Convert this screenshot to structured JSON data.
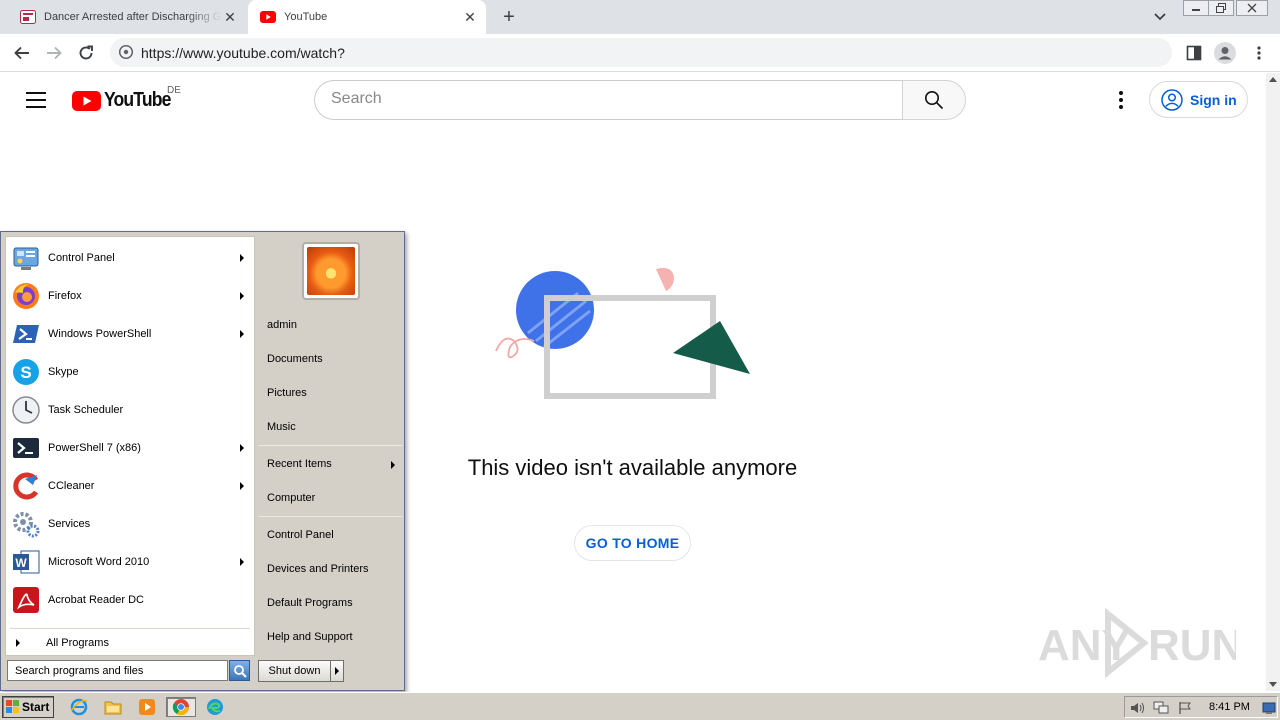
{
  "browser": {
    "tabs": [
      {
        "title": "Dancer Arrested after Discharging G",
        "active": false
      },
      {
        "title": "YouTube",
        "active": true
      }
    ],
    "url": "https://www.youtube.com/watch?"
  },
  "youtube": {
    "logo_text": "YouTube",
    "country_code": "DE",
    "search_placeholder": "Search",
    "sign_in_label": "Sign in",
    "unavailable_message": "This video isn't available anymore",
    "go_home_label": "GO TO HOME",
    "brand_color": "#ff0000",
    "link_color": "#065fd4"
  },
  "start_menu": {
    "programs": [
      {
        "label": "Control Panel",
        "icon": "control-panel-icon",
        "submenu": true
      },
      {
        "label": "Firefox",
        "icon": "firefox-icon",
        "submenu": true
      },
      {
        "label": "Windows PowerShell",
        "icon": "powershell-icon",
        "submenu": true
      },
      {
        "label": "Skype",
        "icon": "skype-icon",
        "submenu": false
      },
      {
        "label": "Task Scheduler",
        "icon": "clock-icon",
        "submenu": false
      },
      {
        "label": "PowerShell 7 (x86)",
        "icon": "powershell7-icon",
        "submenu": true
      },
      {
        "label": "CCleaner",
        "icon": "ccleaner-icon",
        "submenu": true
      },
      {
        "label": "Services",
        "icon": "gears-icon",
        "submenu": false
      },
      {
        "label": "Microsoft Word 2010",
        "icon": "word-icon",
        "submenu": true
      },
      {
        "label": "Acrobat Reader DC",
        "icon": "acrobat-icon",
        "submenu": false
      }
    ],
    "all_programs_label": "All Programs",
    "search_placeholder": "Search programs and files",
    "right_links": {
      "user": "admin",
      "documents": "Documents",
      "pictures": "Pictures",
      "music": "Music",
      "recent_items": "Recent Items",
      "computer": "Computer",
      "control_panel": "Control Panel",
      "devices_printers": "Devices and Printers",
      "default_programs": "Default Programs",
      "help_support": "Help and Support"
    },
    "shutdown_label": "Shut down"
  },
  "taskbar": {
    "start_label": "Start",
    "clock": "8:41 PM"
  },
  "watermark": {
    "left": "ANY",
    "right": "RUN"
  }
}
